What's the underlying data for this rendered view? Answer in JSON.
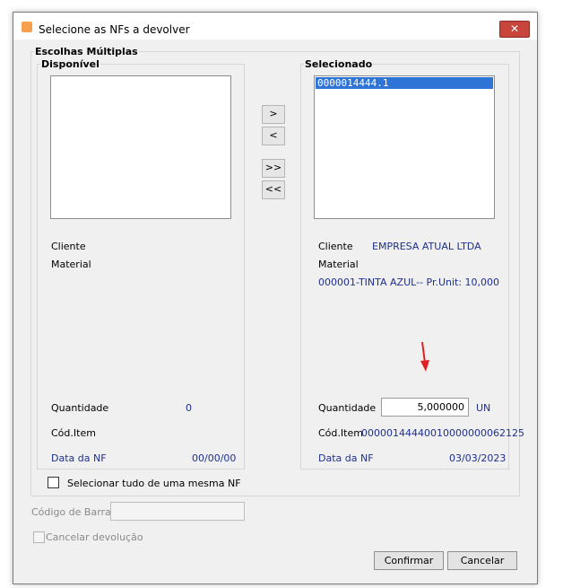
{
  "window": {
    "title": "Selecione as NFs a devolver",
    "close_glyph": "✕"
  },
  "group": {
    "legend": "Escolhas Múltiplas",
    "available": {
      "legend": "Disponível",
      "cliente_label": "Cliente",
      "material_label": "Material",
      "quantidade_label": "Quantidade",
      "quantidade_value": "0",
      "cod_item_label": "Cód.Item",
      "data_nf_label": "Data da NF",
      "data_nf_value": "00/00/00"
    },
    "selected": {
      "legend": "Selecionado",
      "items": [
        "0000014444.1"
      ],
      "cliente_label": "Cliente",
      "cliente_value": "EMPRESA ATUAL LTDA",
      "material_label": "Material",
      "material_value": "000001-TINTA AZUL-- Pr.Unit: 10,000",
      "quantidade_label": "Quantidade",
      "quantidade_value": "5,000000",
      "unit": "UN",
      "cod_item_label": "Cód.Item",
      "cod_item_value": "00000144440010000000062125",
      "data_nf_label": "Data da NF",
      "data_nf_value": "03/03/2023"
    },
    "move_buttons": {
      "add": ">",
      "remove": "<",
      "add_all": ">>",
      "remove_all": "<<"
    },
    "select_all_label": "Selecionar tudo de uma mesma NF"
  },
  "barcode": {
    "label": "Código de Barras",
    "value": ""
  },
  "cancel_return_label": "Cancelar devolução",
  "buttons": {
    "confirm": "Confirmar",
    "cancel": "Cancelar"
  },
  "colors": {
    "selection": "#2e74d6",
    "value_text": "#1f2f8f",
    "close": "#c7453a",
    "arrow": "#e02020"
  }
}
